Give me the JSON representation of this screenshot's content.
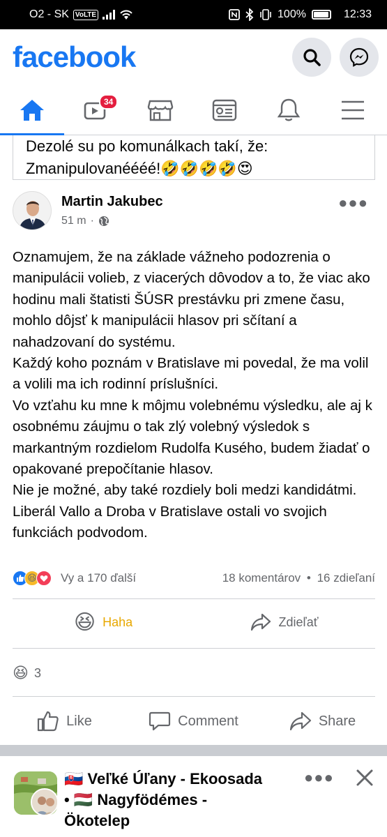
{
  "status_bar": {
    "carrier": "O2 - SK",
    "volte": "VoLTE",
    "battery": "100%",
    "time": "12:33"
  },
  "header": {
    "logo": "facebook",
    "search_icon": "search-icon",
    "messenger_icon": "messenger-icon"
  },
  "nav": {
    "tabs": [
      {
        "name": "home",
        "icon": "home-icon",
        "active": true
      },
      {
        "name": "watch",
        "icon": "video-icon",
        "badge": "34"
      },
      {
        "name": "marketplace",
        "icon": "store-icon"
      },
      {
        "name": "memories",
        "icon": "clock-feed-icon"
      },
      {
        "name": "notifications",
        "icon": "bell-icon"
      },
      {
        "name": "menu",
        "icon": "menu-icon"
      }
    ]
  },
  "shared_snippet": {
    "line1": "Dezolé su po komunálkach takí, že:",
    "line2": "Zmanipulovanéééé!🤣🤣🤣🤣😍"
  },
  "post": {
    "author": "Martin Jakubec",
    "time": "51 m",
    "dot": "·",
    "privacy_icon": "globe-icon",
    "body": [
      "Oznamujem, že na základe vážneho podozrenia o manipulácii volieb, z viacerých dôvodov a to, že viac ako hodinu mali štatisti ŠÚSR prestávku pri zmene času, mohlo dôjsť k manipulácii hlasov pri sčítaní a nahadzovaní do systému.",
      "Každý koho poznám v Bratislave mi povedal, že ma volil a volili ma ich rodinní príslušníci.",
      "Vo vzťahu ku mne k môjmu volebnému výsledku, ale aj k osobnému záujmu o tak zlý volebný výsledok s markantným rozdielom Rudolfa Kusého, budem žiadať o opakované prepočítanie hlasov.",
      "Nie je možné, aby také rozdiely boli medzi kandidátmi.",
      "Liberál Vallo a Droba v Bratislave ostali vo svojich funkciách podvodom."
    ],
    "reactions_text": "Vy a 170 ďalší",
    "comments": "18 komentárov",
    "stats_dot": "•",
    "shares": "16 zdieľaní",
    "haha_label": "Haha",
    "share_label": "Zdieľať"
  },
  "comment_reaction": {
    "emoji": "😆",
    "count": "3"
  },
  "bottom_actions": {
    "like": "Like",
    "comment": "Comment",
    "share": "Share"
  },
  "next_post": {
    "title_line1": "🇸🇰 Veľké Úľany - Ekoosada",
    "title_line2": "• 🇭🇺 Nagyfödémes -",
    "title_line3": "Ökotelep"
  },
  "colors": {
    "brand": "#1877f2",
    "badge": "#e41e3f",
    "secondary_text": "#65676b",
    "haha": "#e8a800"
  }
}
